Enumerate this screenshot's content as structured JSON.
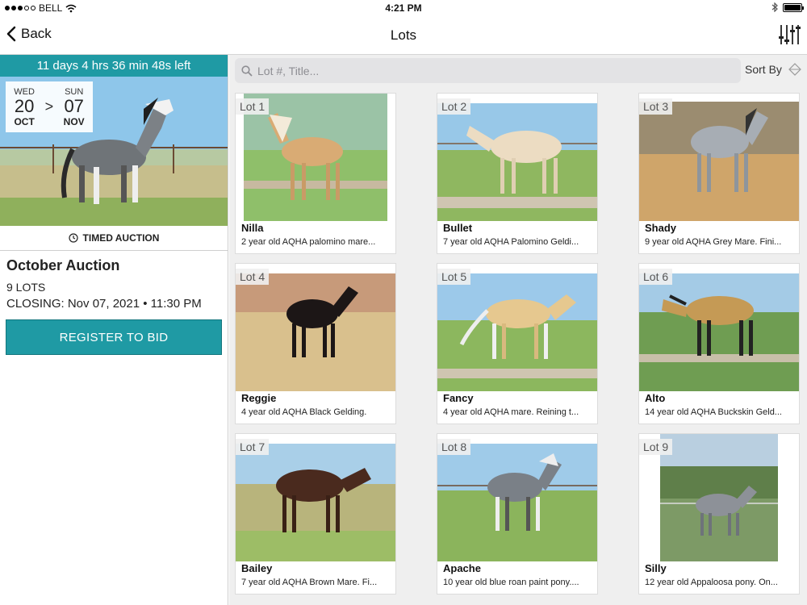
{
  "status_bar": {
    "carrier": "BELL",
    "time": "4:21 PM",
    "icons": [
      "signal-dots-icon",
      "wifi-icon",
      "bluetooth-icon",
      "battery-icon"
    ]
  },
  "nav": {
    "back_label": "Back",
    "title": "Lots",
    "filter_icon": "sliders-icon"
  },
  "auction": {
    "countdown": "11 days 4 hrs 36 min 48s left",
    "start": {
      "dow": "WED",
      "day": "20",
      "month": "OCT"
    },
    "end": {
      "dow": "SUN",
      "day": "07",
      "month": "NOV"
    },
    "date_separator": ">",
    "type_label": "TIMED AUCTION",
    "title": "October Auction",
    "lot_count": "9 LOTS",
    "closing": "CLOSING: Nov 07, 2021 • 11:30 PM",
    "register_label": "REGISTER TO BID"
  },
  "search": {
    "placeholder": "Lot #, Title..."
  },
  "sort": {
    "label": "Sort By"
  },
  "colors": {
    "accent": "#1f9aa4",
    "background": "#efefef"
  },
  "lots": [
    {
      "lot": "Lot 1",
      "name": "Nilla",
      "desc": "2 year old AQHA palomino mare..."
    },
    {
      "lot": "Lot 2",
      "name": "Bullet",
      "desc": "7 year old AQHA Palomino Geldi..."
    },
    {
      "lot": "Lot 3",
      "name": "Shady",
      "desc": "9 year old AQHA Grey Mare. Fini..."
    },
    {
      "lot": "Lot 4",
      "name": "Reggie",
      "desc": "4 year old AQHA Black Gelding."
    },
    {
      "lot": "Lot 5",
      "name": "Fancy",
      "desc": "4 year old AQHA mare. Reining t..."
    },
    {
      "lot": "Lot 6",
      "name": "Alto",
      "desc": "14 year old AQHA Buckskin Geld..."
    },
    {
      "lot": "Lot 7",
      "name": "Bailey",
      "desc": "7 year old AQHA Brown Mare. Fi..."
    },
    {
      "lot": "Lot 8",
      "name": "Apache",
      "desc": "10 year old blue roan paint pony...."
    },
    {
      "lot": "Lot 9",
      "name": "Silly",
      "desc": "12 year old Appaloosa pony. On..."
    }
  ]
}
